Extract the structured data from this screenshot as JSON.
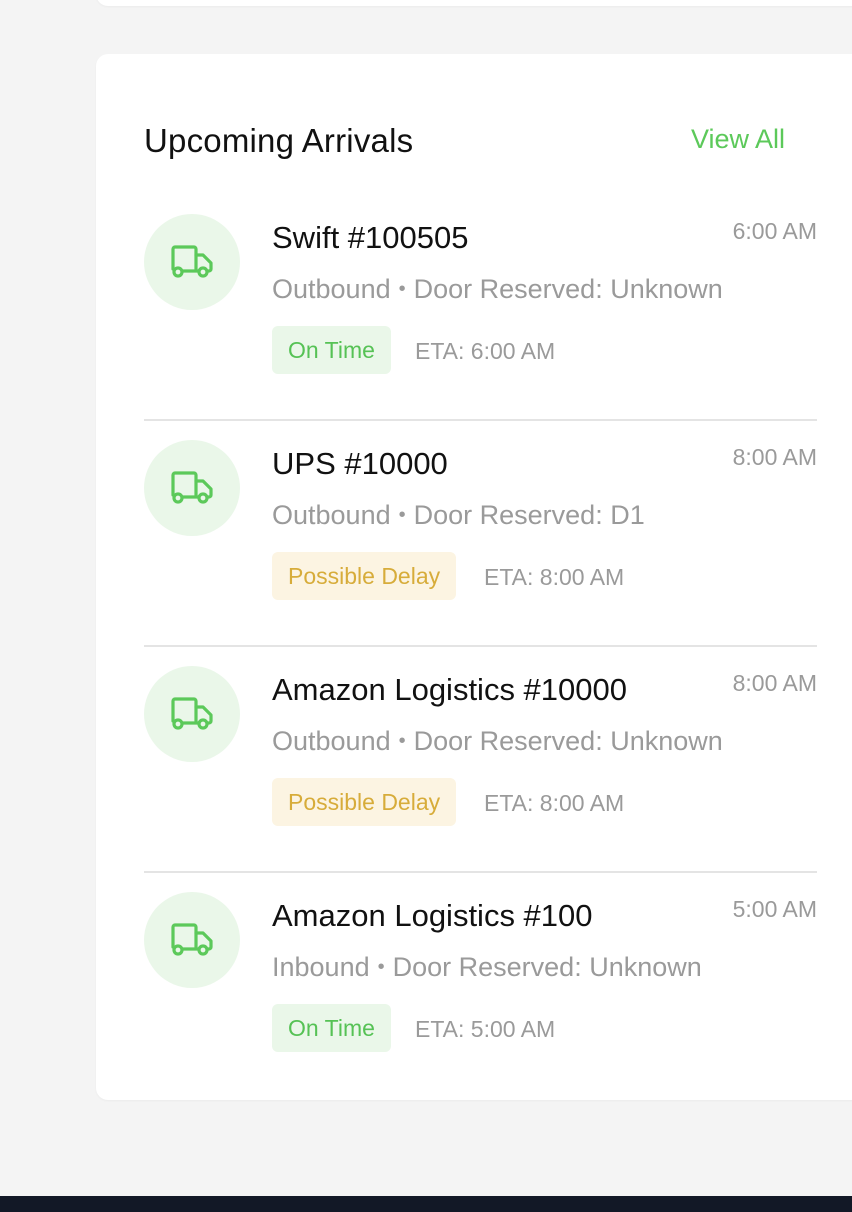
{
  "card": {
    "title": "Upcoming Arrivals",
    "view_all_label": "View All"
  },
  "arrivals": [
    {
      "title": "Swift #100505",
      "time": "6:00 AM",
      "direction": "Outbound",
      "separator": "•",
      "door": "Door Reserved: Unknown",
      "status": "On Time",
      "eta": "ETA: 6:00 AM"
    },
    {
      "title": "UPS #10000",
      "time": "8:00 AM",
      "direction": "Outbound",
      "separator": "•",
      "door": "Door Reserved: D1",
      "status": "Possible Delay",
      "eta": "ETA: 8:00 AM"
    },
    {
      "title": "Amazon Logistics #10000",
      "time": "8:00 AM",
      "direction": "Outbound",
      "separator": "•",
      "door": "Door Reserved: Unknown",
      "status": "Possible Delay",
      "eta": "ETA: 8:00 AM"
    },
    {
      "title": "Amazon Logistics #100",
      "time": "5:00 AM",
      "direction": "Inbound",
      "separator": "•",
      "door": "Door Reserved: Unknown",
      "status": "On Time",
      "eta": "ETA: 5:00 AM"
    }
  ],
  "icons": {
    "arrival": "truck-icon"
  },
  "colors": {
    "accent_green": "#5cc95a",
    "on_time_bg": "#eaf7e9",
    "on_time_text": "#56c255",
    "delay_bg": "#fcf4e2",
    "delay_text": "#d7ac3a",
    "bottom_bar": "#121826"
  }
}
